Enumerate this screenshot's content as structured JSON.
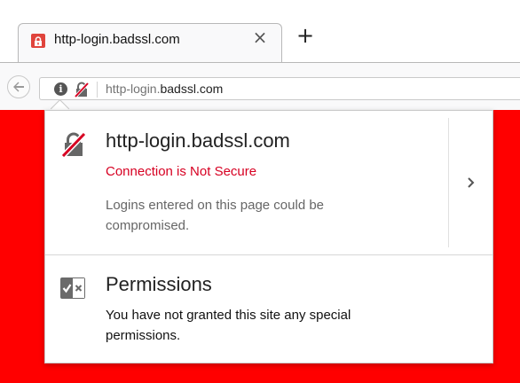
{
  "tab": {
    "title": "http-login.badssl.com",
    "close_glyph": "×"
  },
  "toolbar": {
    "new_tab_glyph": "+"
  },
  "urlbar": {
    "url_prefix": "http-login.",
    "url_domain": "badssl.com"
  },
  "popup": {
    "security": {
      "host": "http-login.badssl.com",
      "status": "Connection is Not Secure",
      "description": "Logins entered on this page could be compromised."
    },
    "permissions": {
      "title": "Permissions",
      "description": "You have not granted this site any special permissions."
    }
  },
  "colors": {
    "page_background": "#ff0000",
    "insecure_text": "#d70022"
  },
  "icons": {
    "favicon": "insecure-lock-favicon",
    "back": "back-arrow-icon",
    "info": "info-icon",
    "insecure_lock": "struck-lock-icon",
    "more": "chevron-right-icon",
    "permissions": "permissions-icon"
  }
}
